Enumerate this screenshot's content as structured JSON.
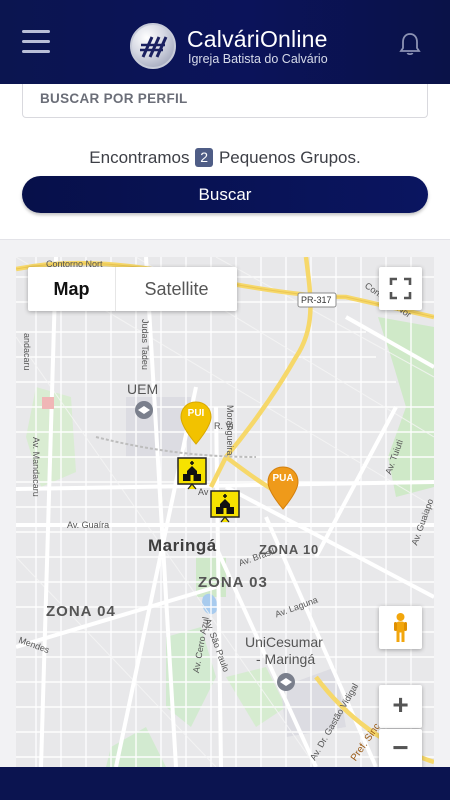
{
  "header": {
    "title": "CalváriOnline",
    "subtitle": "Igreja Batista do Calvário"
  },
  "search": {
    "profile_value": "BUSCAR POR PERFIL",
    "found_prefix": "Encontramos",
    "found_count": "2",
    "found_suffix": "Pequenos Grupos.",
    "button_label": "Buscar"
  },
  "map": {
    "type_map": "Map",
    "type_satellite": "Satellite",
    "labels": {
      "city": "Maringá",
      "zona10": "ZONA 10",
      "zona03": "ZONA 03",
      "zona04": "ZONA 04",
      "uem": "UEM",
      "unicesumar1": "UniCesumar",
      "unicesumar2": "- Maringá",
      "pr317": "PR-317",
      "contorno_top": "Contorno Nort",
      "contorno_right": "Contorno Nor",
      "av_guaira": "Av. Guaíra",
      "av_mandacaru": "Av. Mandacaru",
      "mandacaru": "andacaru",
      "av_brasil": "Av. Brasil",
      "av_laguna": "Av. Laguna",
      "av_sao_paulo": "Av. São Paulo",
      "av_cerro_azul": "Av. Cerro Azul",
      "av_tuiuti": "Av. Tuiuti",
      "av_guaiapo": "Av. Guaiapo",
      "av_gastao": "Av. Dr. Gastão Vidigal",
      "mendes": "Mendes",
      "judas": "Judas Tadeu",
      "morangueira": "Morangueira",
      "pref_sinc": "Pref. Sinc",
      "r_vi": "R. Vi",
      "av_ti": "Av",
      "pin_yellow": "PUI",
      "pin_orange": "PUA"
    },
    "zoom_in": "+",
    "zoom_out": "−",
    "icons": {
      "fullscreen": "fullscreen-icon",
      "pegman": "pegman-icon",
      "church": "church-icon",
      "uem": "graduation-cap-icon",
      "unicesumar": "graduation-cap-icon"
    }
  },
  "colors": {
    "header": "#0b1550",
    "button": "#07104a",
    "badge": "#4f5d86",
    "pin_yellow": "#f2c200",
    "pin_orange": "#ef9a1a"
  }
}
